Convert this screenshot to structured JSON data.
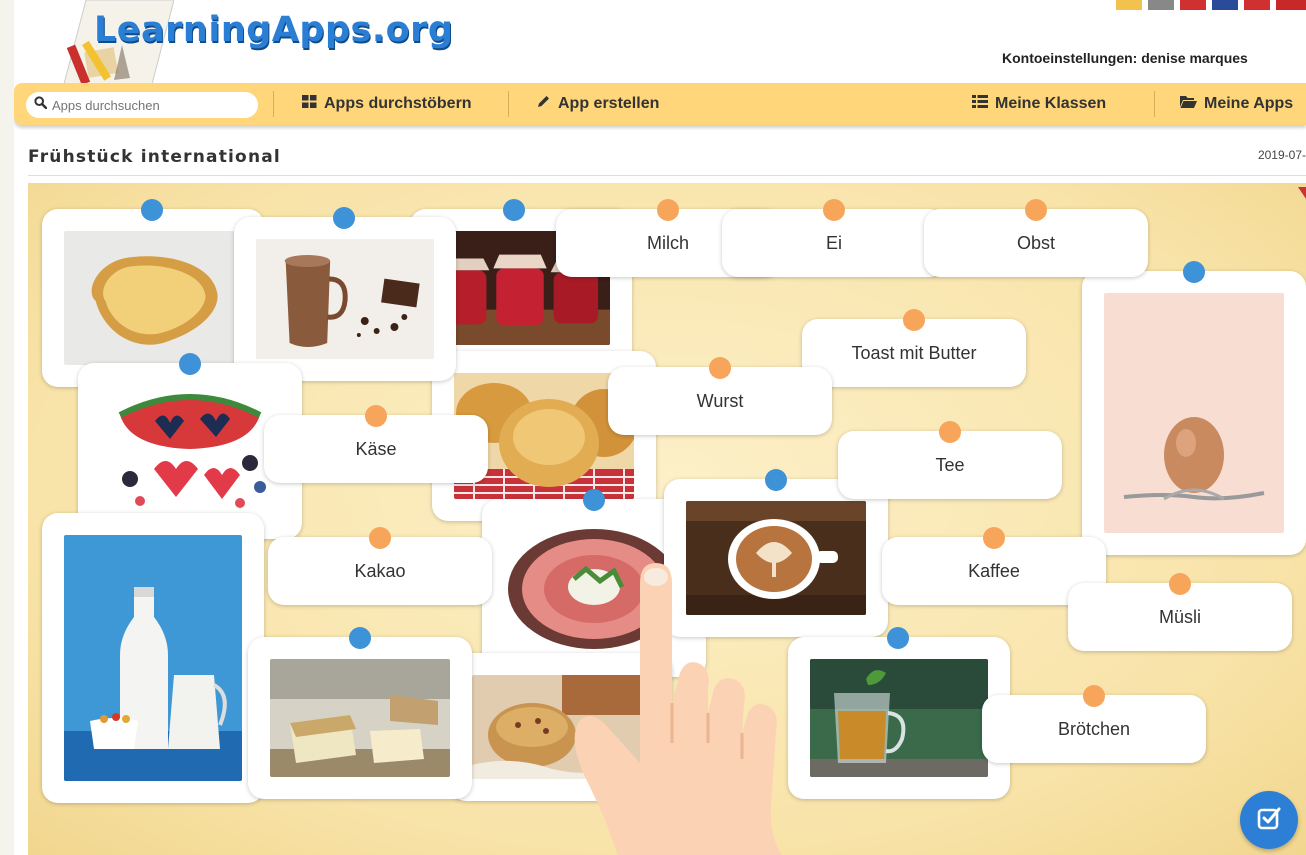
{
  "site": {
    "logo": "LearningApps.org"
  },
  "account": {
    "label": "Kontoeinstellungen: denise marques"
  },
  "nav": {
    "search_placeholder": "Apps durchsuchen",
    "browse": "Apps durchstöbern",
    "create": "App erstellen",
    "classes": "Meine Klassen",
    "apps": "Meine Apps"
  },
  "page": {
    "title": "Frühstück international",
    "date": "2019-07-"
  },
  "text_cards": [
    "Milch",
    "Ei",
    "Obst",
    "Toast mit Butter",
    "Wurst",
    "Käse",
    "Tee",
    "Kakao",
    "Kaffee",
    "Müsli",
    "Brötchen"
  ],
  "icons": {
    "search": "search-icon",
    "browse": "grid-icon",
    "create": "pencil-icon",
    "classes": "list-icon",
    "apps": "folder-icon",
    "check": "check-icon"
  },
  "colors": {
    "navbar": "#ffd67a",
    "image_dot": "#3d92d8",
    "text_dot": "#f7a55a",
    "board": "#f8e3a8",
    "check_button": "#2d7fd5"
  }
}
